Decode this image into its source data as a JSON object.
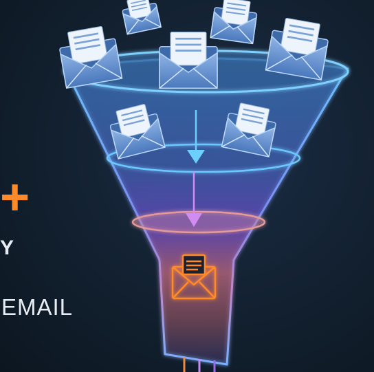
{
  "text": {
    "plus_sign": "+",
    "fragment_y": "Y",
    "fragment_email": "EMAIL"
  },
  "colors": {
    "background": "#12202f",
    "funnel_top": "#4aa8e8",
    "funnel_middle": "#8a5ae0",
    "funnel_bottom": "#f08a3c",
    "accent": "#ff8a2a",
    "envelope": "#5a86c8"
  },
  "icons": [
    "envelope-icon",
    "arrow-down-icon",
    "plus-icon"
  ]
}
